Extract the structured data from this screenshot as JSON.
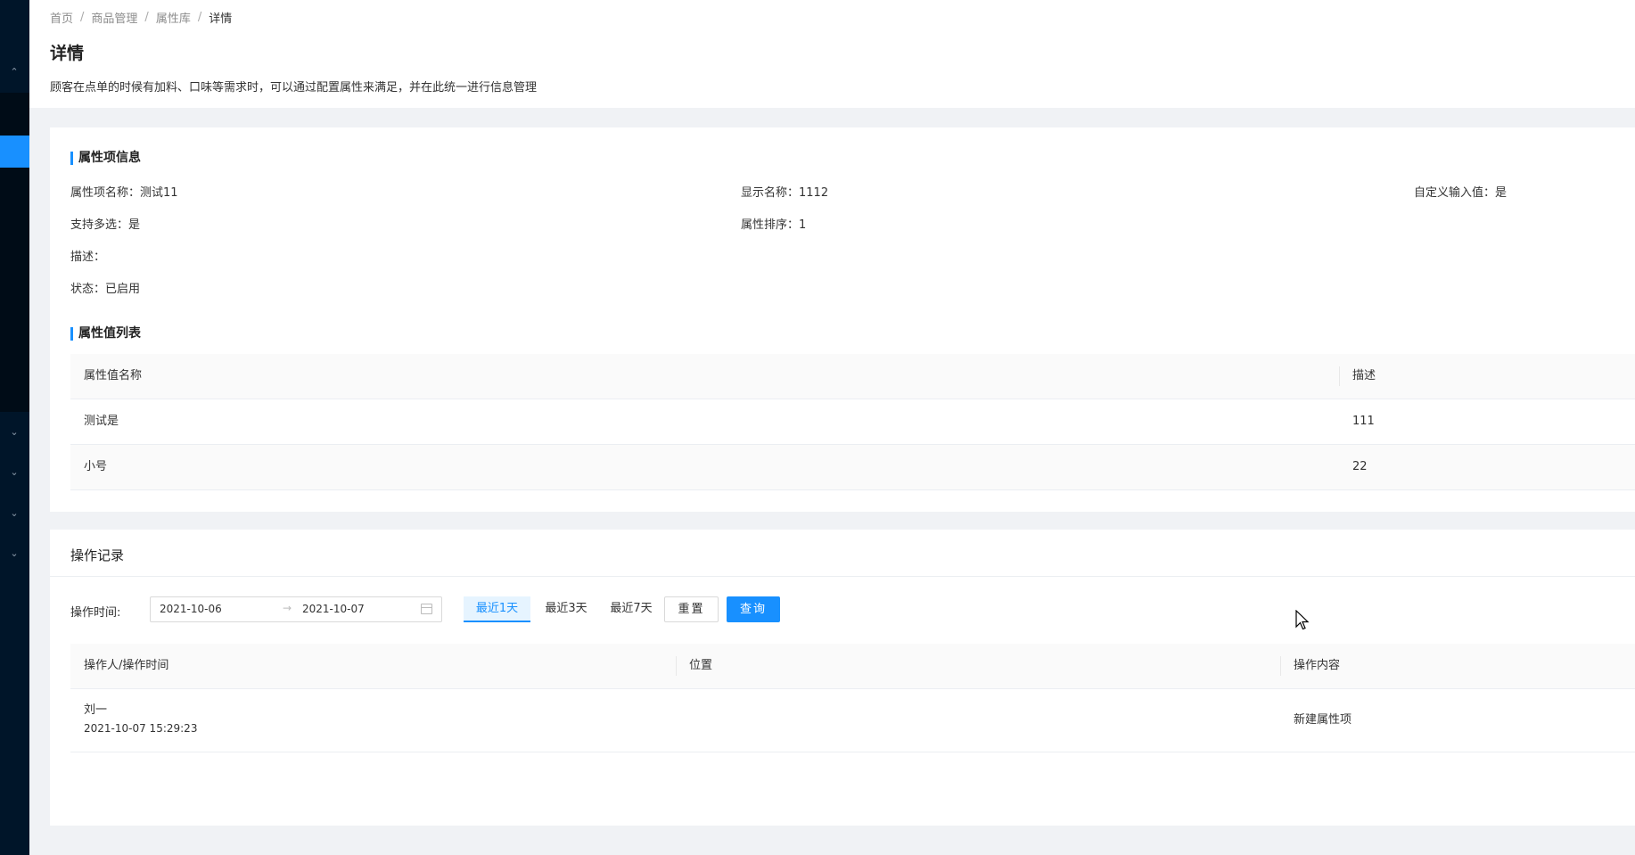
{
  "breadcrumb": {
    "items": [
      "首页",
      "商品管理",
      "属性库"
    ],
    "current": "详情",
    "separator": "/"
  },
  "header": {
    "title": "详情",
    "description": "顾客在点单的时候有加料、口味等需求时，可以通过配置属性来满足，并在此统一进行信息管理"
  },
  "sidebar": {
    "icons": [
      "chevron-up-icon",
      "chevron-down-icon",
      "chevron-down-icon",
      "chevron-down-icon",
      "chevron-down-icon"
    ]
  },
  "attr_info": {
    "section_title": "属性项信息",
    "name": "属性项名称：测试11",
    "display_name": "显示名称：1112",
    "custom_input": "自定义输入值：是",
    "multi_select": "支持多选：是",
    "sort": "属性排序：1",
    "description": "描述：",
    "status": "状态：已启用"
  },
  "value_list": {
    "section_title": "属性值列表",
    "columns": [
      "属性值名称",
      "描述"
    ],
    "rows": [
      {
        "name": "测试是",
        "desc": "111"
      },
      {
        "name": "小号",
        "desc": "22"
      }
    ]
  },
  "records": {
    "title": "操作记录",
    "filter_label": "操作时间:",
    "start_date": "2021-10-06",
    "end_date": "2021-10-07",
    "range_arrow": "→",
    "quick_ranges": [
      "最近1天",
      "最近3天",
      "最近7天"
    ],
    "active_quick": "最近1天",
    "reset_label": "重置",
    "query_label": "查询",
    "columns": [
      "操作人/操作时间",
      "位置",
      "操作内容"
    ],
    "rows": [
      {
        "operator": "刘一",
        "time": "2021-10-07 15:29:23",
        "location": "",
        "content": "新建属性项"
      }
    ]
  },
  "colors": {
    "accent": "#1890ff",
    "sidebar": "#001529"
  }
}
